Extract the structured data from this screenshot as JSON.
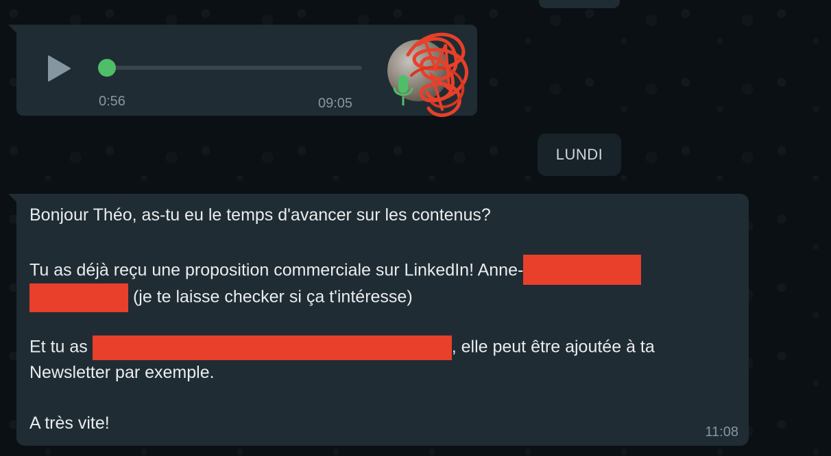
{
  "voice_message": {
    "elapsed": "0:56",
    "time": "09:05",
    "progress": 0
  },
  "day_divider": {
    "label": "LUNDI"
  },
  "text_message": {
    "line1": "Bonjour Théo, as-tu eu le temps d'avancer sur les contenus?",
    "line2_prefix": "Tu as déjà reçu une proposition commerciale sur LinkedIn! Anne-",
    "line3_suffix": " (je te laisse checker si ça t'intéresse)",
    "line4_prefix": "Et tu as ",
    "line4_suffix": ", elle peut être ajoutée à ta",
    "line5": "Newsletter par exemple.",
    "line6": "A très vite!",
    "time": "11:08"
  },
  "colors": {
    "bubble": "#202c33",
    "accent_green": "#4fbe68",
    "redaction": "#e8402a"
  }
}
